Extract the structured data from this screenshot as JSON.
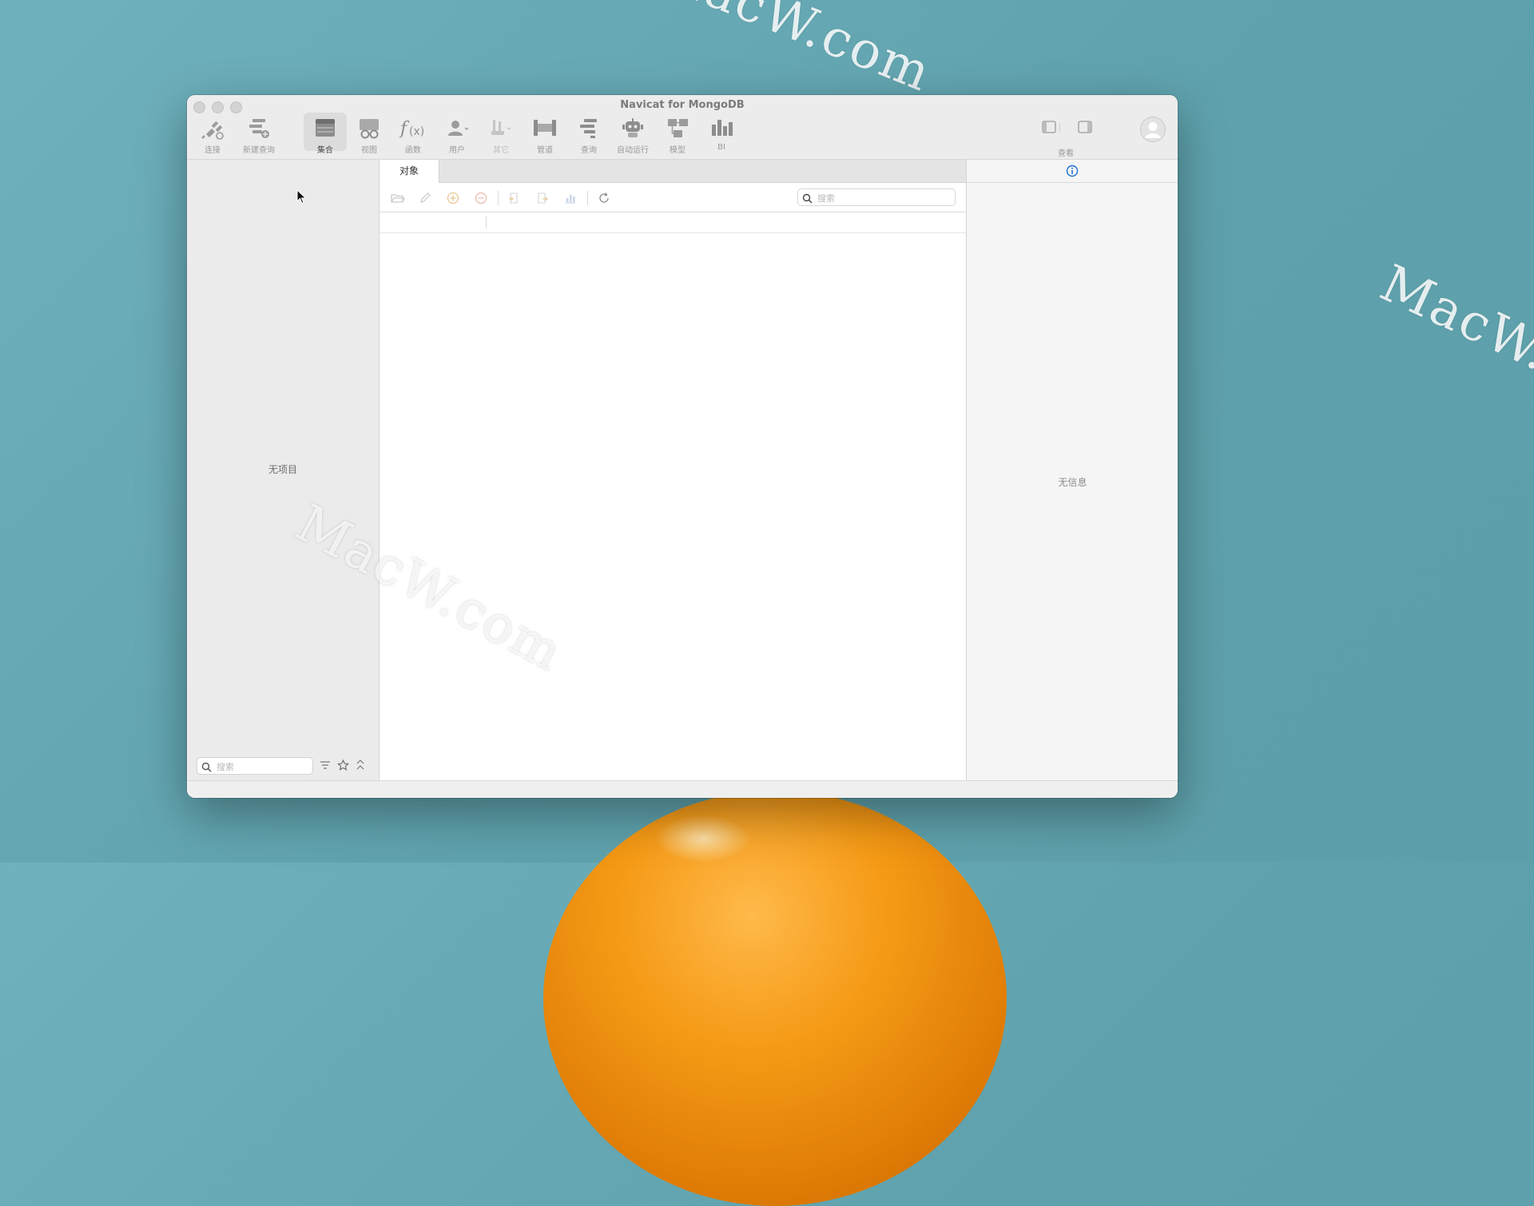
{
  "window": {
    "title": "Navicat for MongoDB",
    "accent_color": "#1e6fd9"
  },
  "toolbar": {
    "items": [
      {
        "label": "连接",
        "icon": "plug-icon"
      },
      {
        "label": "新建查询",
        "icon": "new-query-icon"
      },
      {
        "label": "集合",
        "icon": "collection-icon",
        "active": true
      },
      {
        "label": "视图",
        "icon": "view-glasses-icon"
      },
      {
        "label": "函数",
        "icon": "function-icon"
      },
      {
        "label": "用户",
        "icon": "user-icon"
      },
      {
        "label": "其它",
        "icon": "other-tools-icon",
        "disabled": true
      },
      {
        "label": "管道",
        "icon": "pipeline-icon"
      },
      {
        "label": "查询",
        "icon": "query-icon"
      },
      {
        "label": "自动运行",
        "icon": "robot-icon"
      },
      {
        "label": "模型",
        "icon": "model-icon"
      },
      {
        "label": "BI",
        "icon": "bi-chart-icon"
      }
    ],
    "view_label": "查看"
  },
  "sidebar": {
    "empty_text": "无项目",
    "search_placeholder": "搜索"
  },
  "center": {
    "tab_label": "对象",
    "search_placeholder": "搜索"
  },
  "rightpanel": {
    "empty_text": "无信息"
  },
  "desktop": {
    "watermark_1": "MacW.com",
    "watermark_2": "MacW.c",
    "watermark_3": "MacW.com"
  }
}
